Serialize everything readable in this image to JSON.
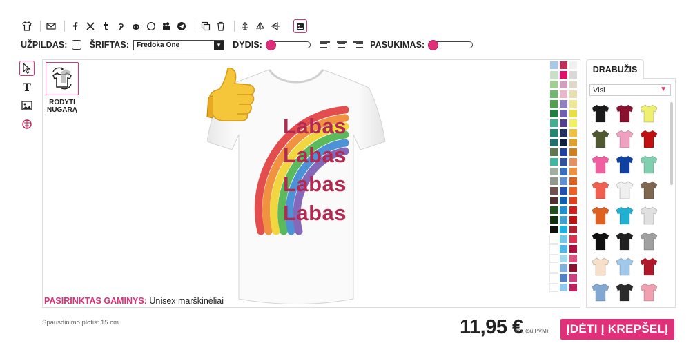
{
  "toolbar": {
    "icons": [
      "tshirt-icon",
      "email-icon",
      "facebook-icon",
      "x-icon",
      "tumblr-icon",
      "pinterest-icon",
      "reddit-icon",
      "whatsapp-icon",
      "myspace-icon",
      "telegram-icon",
      "duplicate-icon",
      "trash-icon",
      "align-center-icon",
      "flip-vertical-icon",
      "flip-horizontal-icon",
      "image-edit-icon"
    ]
  },
  "options": {
    "fill_label": "UŽPILDAS:",
    "font_label": "ŠRIFTAS:",
    "font_value": "Fredoka One",
    "size_label": "DYDIS:",
    "rotation_label": "PASUKIMAS:"
  },
  "tools": [
    "select-icon",
    "text-icon",
    "image-icon",
    "clipart-icon"
  ],
  "canvas": {
    "back_label_1": "RODYTI",
    "back_label_2": "NUGARĄ",
    "shirt_lines": [
      "Labas",
      "Labas",
      "Labas",
      "Labas"
    ],
    "selected_key": "PASIRINKTAS GAMINYS:",
    "selected_value": "Unisex marškinėliai"
  },
  "palette": [
    "#a8c8e8",
    "#c0305a",
    "#f0f0f0",
    "#c8e0c8",
    "#e0106a",
    "#d8d8d8",
    "#a0d090",
    "#d0a0c0",
    "#e0d8c8",
    "#70b870",
    "#e8b8c8",
    "#e8e0b0",
    "#50a050",
    "#9080c0",
    "#f0e898",
    "#208040",
    "#7060b0",
    "#e8e040",
    "#40b090",
    "#504090",
    "#f0f060",
    "#208870",
    "#203060",
    "#f0c040",
    "#207070",
    "#102040",
    "#e0a030",
    "#607850",
    "#2040a0",
    "#d08020",
    "#40b8a0",
    "#3050a0",
    "#e89060",
    "#a0b0a0",
    "#3870c0",
    "#f09040",
    "#909890",
    "#6090d0",
    "#e06020",
    "#705050",
    "#2050b0",
    "#f06020",
    "#503030",
    "#1060b0",
    "#e04020",
    "#205020",
    "#2090d0",
    "#d02020",
    "#103010",
    "#40a0d0",
    "#c01010",
    "#101010",
    "#20b0e0",
    "#b02030",
    "#ffffff",
    "#70c8e8",
    "#e03050",
    "#ffffff",
    "#50b8e8",
    "#b01040",
    "#ffffff",
    "#a0d8f0",
    "#e05080",
    "#ffffff",
    "#80b0e0",
    "#901030",
    "#ffffff",
    "#5080c8",
    "#d04080",
    "#ffffff",
    "#90c8f0",
    "#c02060"
  ],
  "panel": {
    "tab_label": "DRABUŽIS",
    "category_value": "Visi",
    "products": [
      "#1a1a1a",
      "#8a1030",
      "#f0f070",
      "#505a30",
      "#f0a0c0",
      "#c01010",
      "#f060a0",
      "#1040a0",
      "#80d0b0",
      "#f06050",
      "#f0f0f0",
      "#806850",
      "#e06020",
      "#20b0d0",
      "#e0e0e0",
      "#101010",
      "#202020",
      "#a0a0a0",
      "#f8e0c8",
      "#a0c8e8",
      "#b01828",
      "#80a8d0",
      "#2a2a2a",
      "#f0a0b0"
    ]
  },
  "footer": {
    "print_width": "Spausdinimo plotis: 15 cm.",
    "price": "11,95 €",
    "price_note": "vnt. (su PVM)",
    "cart_label": "ĮDĖTI Į KREPŠELĮ"
  }
}
